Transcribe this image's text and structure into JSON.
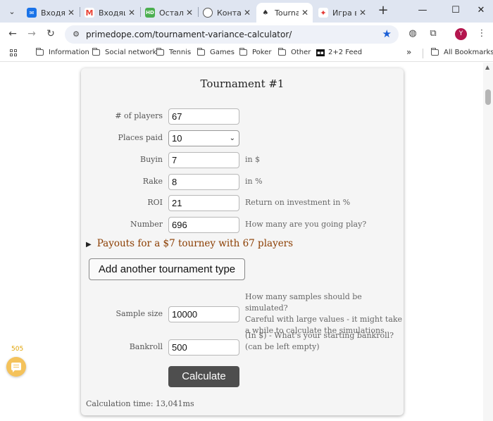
{
  "browser": {
    "tabs": [
      {
        "title": "Входящие",
        "favicon_letter": "",
        "color": "#1a73e8"
      },
      {
        "title": "Входящие",
        "favicon_letter": "M",
        "color": "#ea4335"
      },
      {
        "title": "Осталось",
        "favicon_letter": "HD",
        "color": "#4caf50"
      },
      {
        "title": "Контакт",
        "favicon_letter": "",
        "color": "#555555"
      },
      {
        "title": "Tournament",
        "favicon_letter": "",
        "color": "#333333"
      },
      {
        "title": "Игра в",
        "favicon_letter": "",
        "color": "#e53935"
      }
    ],
    "new_tab_label": "+",
    "url": "primedope.com/tournament-variance-calculator/",
    "profile_initial": "Y",
    "bookmarks": [
      {
        "label": "Information"
      },
      {
        "label": "Social network"
      },
      {
        "label": "Tennis"
      },
      {
        "label": "Games"
      },
      {
        "label": "Poker"
      },
      {
        "label": "Other"
      },
      {
        "label": "2+2 Feed"
      }
    ],
    "bookmarks_overflow": "»",
    "all_bookmarks": "All Bookmarks"
  },
  "side": {
    "counter": "505"
  },
  "form": {
    "title": "Tournament #1",
    "players": {
      "label": "# of players",
      "value": "67"
    },
    "places_paid": {
      "label": "Places paid",
      "value": "10"
    },
    "buyin": {
      "label": "Buyin",
      "value": "7",
      "hint": "in $"
    },
    "rake": {
      "label": "Rake",
      "value": "8",
      "hint": "in %"
    },
    "roi": {
      "label": "ROI",
      "value": "21",
      "hint": "Return on investment in %"
    },
    "number": {
      "label": "Number",
      "value": "696",
      "hint": "How many are you going play?"
    },
    "payouts_summary": "Payouts for a $7 tourney with 67 players",
    "add_tournament_label": "Add another tournament type",
    "sample_size": {
      "label": "Sample size",
      "value": "10000",
      "hint_lines": [
        "How many samples should be simulated?",
        "Careful with large values - it might take",
        "a while to calculate the simulations."
      ]
    },
    "bankroll": {
      "label": "Bankroll",
      "value": "500",
      "hint_lines": [
        "(In $) - What's your starting bankroll?",
        "(can be left empty)"
      ]
    },
    "calculate_label": "Calculate",
    "calculation_time": "Calculation time: 13,041ms"
  }
}
